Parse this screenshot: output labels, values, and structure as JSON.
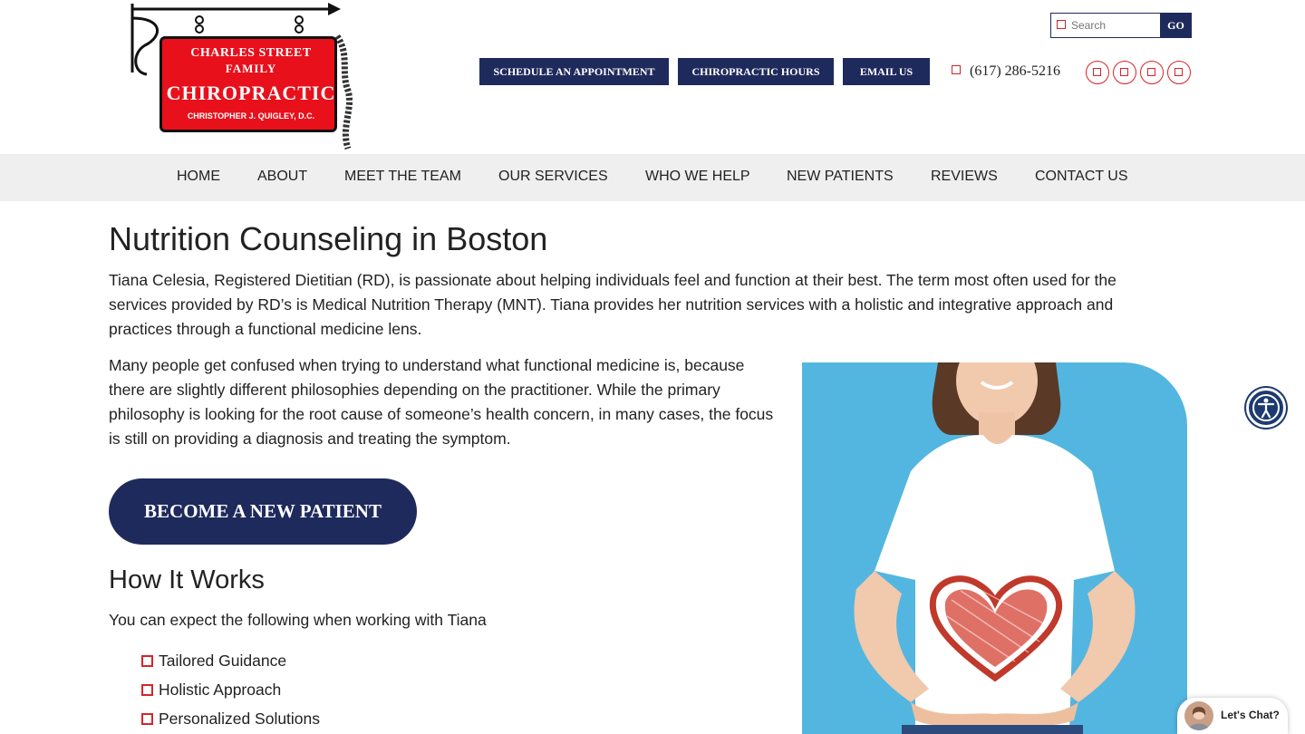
{
  "brand": {
    "line1": "CHARLES STREET",
    "line2": "FAMILY",
    "line3": "CHIROPRACTIC",
    "line4": "CHRISTOPHER J. QUIGLEY, D.C.",
    "sign_color": "#e8101b"
  },
  "search": {
    "placeholder": "Search",
    "go_label": "GO"
  },
  "top_buttons": {
    "schedule": "SCHEDULE AN APPOINTMENT",
    "hours": "CHIROPRACTIC HOURS",
    "email": "EMAIL US"
  },
  "phone": "(617) 286-5216",
  "social_icons": [
    "facebook-icon",
    "instagram-icon",
    "twitter-icon",
    "youtube-icon"
  ],
  "nav": {
    "items": [
      "HOME",
      "ABOUT",
      "MEET THE TEAM",
      "OUR SERVICES",
      "WHO WE HELP",
      "NEW PATIENTS",
      "REVIEWS",
      "CONTACT US"
    ]
  },
  "main": {
    "title": "Nutrition Counseling in Boston",
    "intro": "Tiana Celesia, Registered Dietitian (RD), is passionate about helping individuals feel and function at their best. The term most often used for the services provided by RD’s is Medical Nutrition Therapy (MNT). Tiana provides her nutrition services with a holistic and integrative approach and practices through a functional medicine lens.",
    "paragraph2": "Many people get confused when trying to understand what functional medicine is, because there are slightly different philosophies depending on the practitioner. While the primary philosophy is looking for the root cause of someone’s health concern, in many cases, the focus is still on providing a diagnosis and treating the symptom.",
    "cta_label": "BECOME A NEW PATIENT",
    "how_title": "How It Works",
    "how_intro": "You can expect the following when working with Tiana",
    "how_list": [
      "Tailored Guidance",
      "Holistic Approach",
      "Personalized Solutions"
    ]
  },
  "chat": {
    "label": "Let's Chat?"
  },
  "colors": {
    "navy": "#1f2a5c",
    "accent_red": "#d8232a",
    "nav_bg": "#efefef",
    "photo_bg": "#53b6e0"
  }
}
